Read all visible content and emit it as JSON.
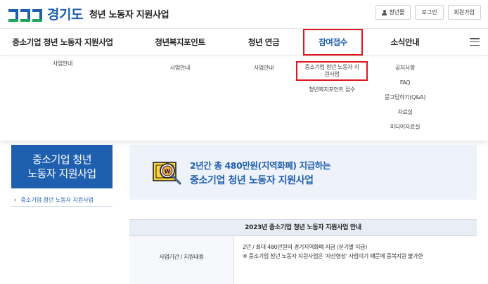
{
  "header": {
    "logo_text": "경기도",
    "site_title": "청년 노동자 지원사업",
    "util": {
      "youth": "청년몰",
      "login": "로그인",
      "join": "회원가입"
    }
  },
  "gnb": {
    "items": [
      {
        "label": "중소기업 청년 노동자 지원사업"
      },
      {
        "label": "청년복지포인트"
      },
      {
        "label": "청년 연금"
      },
      {
        "label": "참여접수"
      },
      {
        "label": "소식안내"
      }
    ],
    "active_index": 3
  },
  "dropdown": {
    "col1": [
      "사업안내"
    ],
    "col2": [
      "사업안내"
    ],
    "col3": [
      "사업안내"
    ],
    "col4": [
      "중소기업 청년 노동자 지원사업",
      "청년복지포인트 접수"
    ],
    "col5": [
      "공지사항",
      "FAQ",
      "묻고답하기(Q&A)",
      "자료실",
      "미디어자료실"
    ]
  },
  "side": {
    "title_line1": "중소기업 청년",
    "title_line2": "노동자 지원사업",
    "link": "중소기업 청년 노동자 지원사업"
  },
  "banner": {
    "line1": "2년간 총 480만원(지역화폐) 지급하는",
    "line2": "중소기업 청년 노동자 지원사업"
  },
  "info_table": {
    "title": "2023년 중소기업 청년 노동자 지원사업 안내",
    "row_label": "사업기간 / 지원내용",
    "row_value_1": "2년 / 최대 480만원의 경기지역화폐 지급 (분기별 지급)",
    "row_value_2": "※ 중소기업 청년 노동자 지원사업은 '자산형성' 사업이기 때문에 중복지원 불가한"
  },
  "colors": {
    "brand_blue": "#1f5fb0",
    "brand_green": "#19a35b",
    "highlight_red": "#e0171d"
  }
}
